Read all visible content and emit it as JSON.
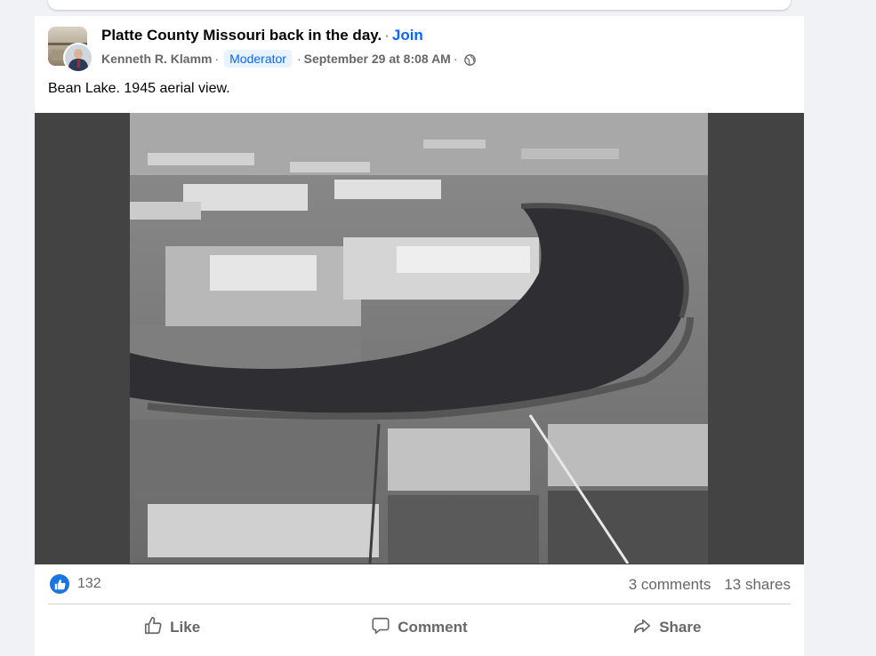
{
  "post": {
    "group_name": "Platte County Missouri back in the day.",
    "join_label": "Join",
    "author": "Kenneth R. Klamm",
    "role_badge": "Moderator",
    "timestamp": "September 29 at 8:08 AM",
    "privacy_icon": "globe-icon",
    "text": "Bean Lake. 1945 aerial view.",
    "separator": "·"
  },
  "stats": {
    "reaction_icon": "like-icon",
    "reaction_count": "132",
    "comments": "3 comments",
    "shares": "13 shares"
  },
  "actions": {
    "like": "Like",
    "comment": "Comment",
    "share": "Share"
  },
  "colors": {
    "accent": "#0866ff",
    "like_badge": "#1b74e4",
    "muted_text": "#65676b"
  }
}
